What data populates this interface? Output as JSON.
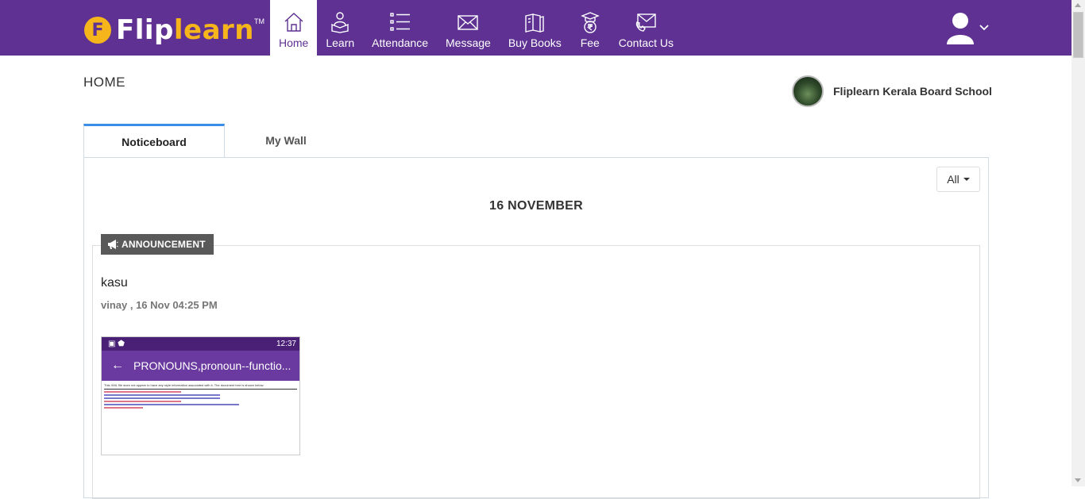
{
  "brand": {
    "logo_letter": "F",
    "name_part1": "Flip",
    "name_part2": "learn",
    "tm": "TM"
  },
  "nav": {
    "items": [
      {
        "label": "Home",
        "icon": "home-icon",
        "active": true
      },
      {
        "label": "Learn",
        "icon": "learn-icon"
      },
      {
        "label": "Attendance",
        "icon": "attendance-icon"
      },
      {
        "label": "Message",
        "icon": "message-icon"
      },
      {
        "label": "Buy Books",
        "icon": "books-icon"
      },
      {
        "label": "Fee",
        "icon": "fee-icon"
      },
      {
        "label": "Contact Us",
        "icon": "contact-icon"
      }
    ]
  },
  "user": {
    "avatar_icon": "user-avatar-icon",
    "menu_icon": "chevron-down-icon"
  },
  "page": {
    "title": "HOME"
  },
  "school": {
    "name": "Fliplearn Kerala Board School"
  },
  "tabs": [
    {
      "label": "Noticeboard",
      "active": true
    },
    {
      "label": "My Wall"
    }
  ],
  "filter": {
    "selected": "All"
  },
  "feed": {
    "date_heading": "16 NOVEMBER",
    "post": {
      "badge": "ANNOUNCEMENT",
      "title": "kasu",
      "meta": "vinay , 16 Nov 04:25 PM",
      "attachment": {
        "status_time": "12:37",
        "app_title": "PRONOUNS,pronoun--functio...",
        "notice": "This XML file does not appear to have any style information associated with it. The document tree is shown below."
      }
    }
  },
  "colors": {
    "brand_purple": "#5e3192",
    "brand_yellow": "#f5b51b",
    "tab_accent": "#3a8ee6",
    "badge_bg": "#595959"
  }
}
